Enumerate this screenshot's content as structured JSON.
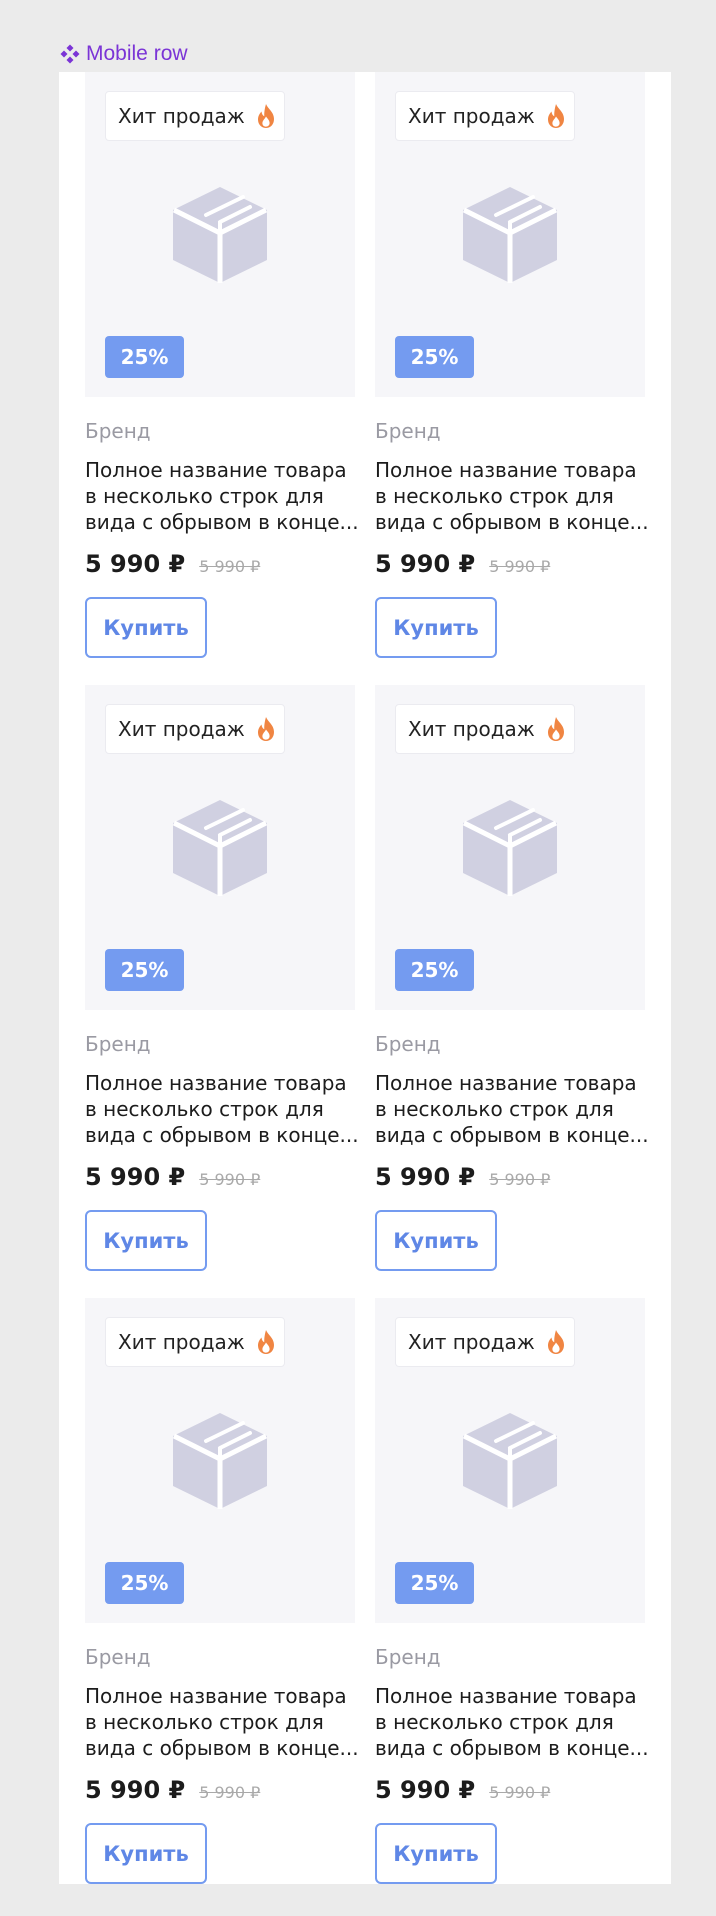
{
  "frame_label": "Mobile row",
  "colors": {
    "label_purple": "#7b34d6",
    "accent_blue": "#749bf0",
    "image_bg": "#f6f6f9",
    "placeholder_gray": "#d0d0e1",
    "fire_orange": "#f08542"
  },
  "icons": {
    "frame": "component-icon",
    "hit": "fire-icon",
    "placeholder": "box-placeholder-icon"
  },
  "products": [
    {
      "hit_label": "Хит продаж",
      "discount": "25%",
      "brand": "Бренд",
      "title": "Полное название товара в несколько строк для вида с обрывом в конце...",
      "price": "5 990 ₽",
      "old_price": "5 990 ₽",
      "buy_label": "Купить"
    },
    {
      "hit_label": "Хит продаж",
      "discount": "25%",
      "brand": "Бренд",
      "title": "Полное название товара в несколько строк для вида с обрывом в конце...",
      "price": "5 990 ₽",
      "old_price": "5 990 ₽",
      "buy_label": "Купить"
    },
    {
      "hit_label": "Хит продаж",
      "discount": "25%",
      "brand": "Бренд",
      "title": "Полное название товара в несколько строк для вида с обрывом в конце...",
      "price": "5 990 ₽",
      "old_price": "5 990 ₽",
      "buy_label": "Купить"
    },
    {
      "hit_label": "Хит продаж",
      "discount": "25%",
      "brand": "Бренд",
      "title": "Полное название товара в несколько строк для вида с обрывом в конце...",
      "price": "5 990 ₽",
      "old_price": "5 990 ₽",
      "buy_label": "Купить"
    },
    {
      "hit_label": "Хит продаж",
      "discount": "25%",
      "brand": "Бренд",
      "title": "Полное название товара в несколько строк для вида с обрывом в конце...",
      "price": "5 990 ₽",
      "old_price": "5 990 ₽",
      "buy_label": "Купить"
    },
    {
      "hit_label": "Хит продаж",
      "discount": "25%",
      "brand": "Бренд",
      "title": "Полное название товара в несколько строк для вида с обрывом в конце...",
      "price": "5 990 ₽",
      "old_price": "5 990 ₽",
      "buy_label": "Купить"
    }
  ]
}
